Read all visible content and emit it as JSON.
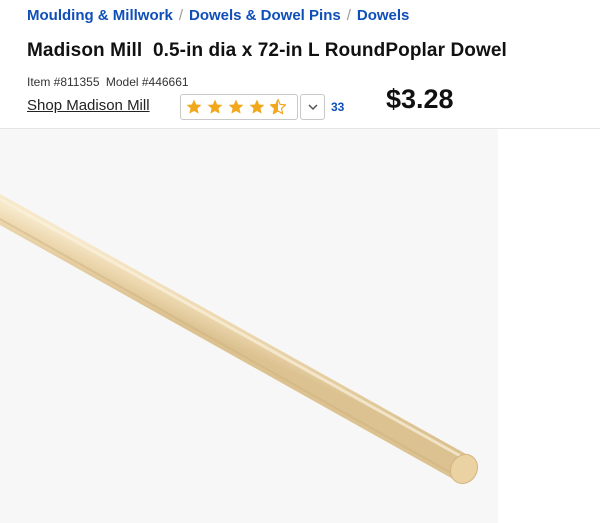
{
  "breadcrumb": {
    "items": [
      "Moulding & Millwork",
      "Dowels & Dowel Pins",
      "Dowels"
    ],
    "separator": "/"
  },
  "product": {
    "title": "Madison Mill  0.5-in dia x 72-in L RoundPoplar Dowel",
    "item_label": "Item #811355",
    "model_label": "Model #446661",
    "shop_link": "Shop Madison Mill",
    "rating": 4.5,
    "rating_max": 5,
    "review_count": "33",
    "price": "$3.28"
  },
  "icons": {
    "star": "star-icon",
    "half_star": "half-star-icon",
    "chevron": "chevron-down-icon"
  },
  "colors": {
    "link_blue": "#0f4fb8",
    "star_orange": "#f2a81d",
    "wood": "#ecd9b3"
  }
}
